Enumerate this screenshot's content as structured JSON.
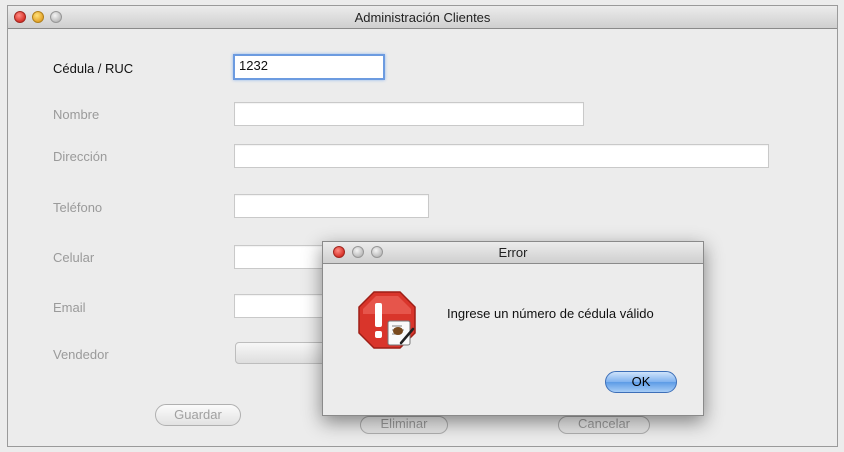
{
  "window": {
    "title": "Administración Clientes"
  },
  "form": {
    "cedula_label": "Cédula / RUC",
    "cedula_value": "1232",
    "nombre_label": "Nombre",
    "direccion_label": "Dirección",
    "telefono_label": "Teléfono",
    "celular_label": "Celular",
    "email_label": "Email",
    "vendedor_label": "Vendedor"
  },
  "buttons": {
    "guardar": "Guardar",
    "eliminar": "Eliminar",
    "cancelar": "Cancelar"
  },
  "dialog": {
    "title": "Error",
    "message": "Ingrese un número de cédula válido",
    "ok": "OK",
    "icon": "alert-stop-icon"
  }
}
